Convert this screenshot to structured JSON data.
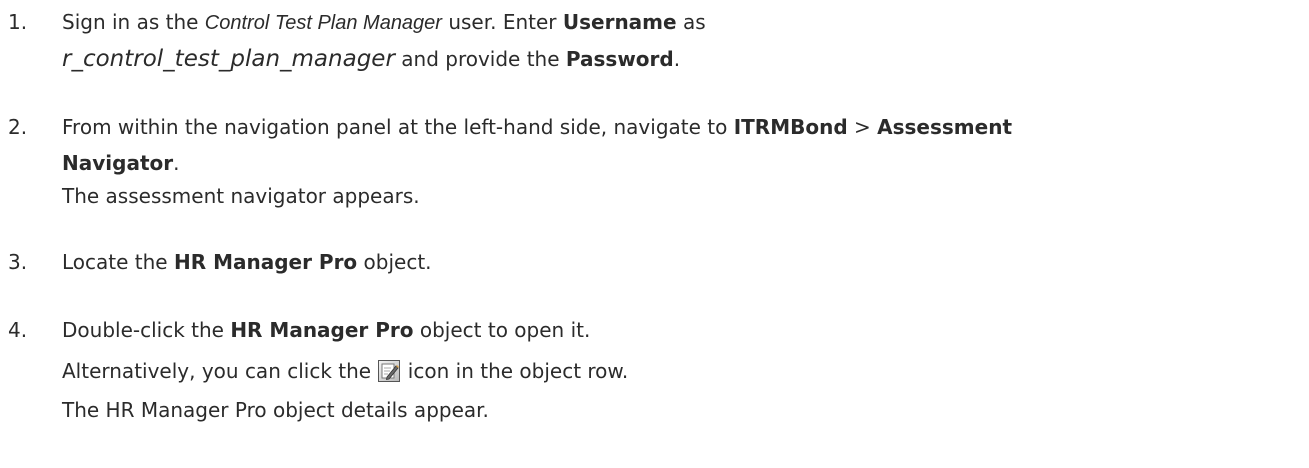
{
  "steps": [
    {
      "number": "1.",
      "lines": [
        {
          "parts": [
            {
              "t": "Sign in as the "
            },
            {
              "t": "Control Test Plan Manager",
              "style": "ital"
            },
            {
              "t": " user. Enter "
            },
            {
              "t": "Username",
              "style": "bold"
            },
            {
              "t": " as"
            }
          ]
        },
        {
          "parts": [
            {
              "t": "r_control_test_plan_manager",
              "style": "ital-big"
            },
            {
              "t": " and provide the "
            },
            {
              "t": "Password",
              "style": "bold"
            },
            {
              "t": "."
            }
          ]
        }
      ]
    },
    {
      "number": "2.",
      "lines": [
        {
          "parts": [
            {
              "t": "From within the navigation panel at the left-hand side, navigate to "
            },
            {
              "t": "ITRMBond",
              "style": "bold"
            },
            {
              "t": " > "
            },
            {
              "t": "Assessment",
              "style": "bold"
            }
          ]
        },
        {
          "parts": [
            {
              "t": "Navigator",
              "style": "bold"
            },
            {
              "t": "."
            }
          ]
        },
        {
          "parts": [
            {
              "t": "The assessment navigator appears."
            }
          ]
        }
      ]
    },
    {
      "number": "3.",
      "lines": [
        {
          "parts": [
            {
              "t": "Locate the "
            },
            {
              "t": "HR Manager Pro",
              "style": "bold"
            },
            {
              "t": " object."
            }
          ]
        }
      ]
    },
    {
      "number": "4.",
      "lines": [
        {
          "parts": [
            {
              "t": "Double-click the "
            },
            {
              "t": "HR Manager Pro",
              "style": "bold"
            },
            {
              "t": " object to open it."
            }
          ]
        },
        {
          "parts": [
            {
              "t": "Alternatively, you can click the "
            },
            {
              "icon": "edit-icon"
            },
            {
              "t": " icon in the object row."
            }
          ]
        },
        {
          "parts": [
            {
              "t": "The HR Manager Pro object details appear."
            }
          ]
        }
      ]
    }
  ]
}
